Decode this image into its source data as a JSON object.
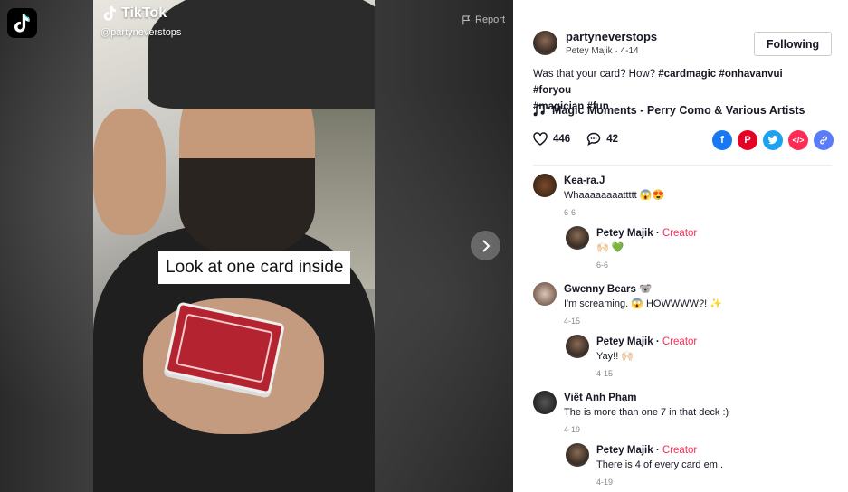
{
  "app": {
    "brand": "TikTok",
    "handle": "@partyneverstops",
    "report_label": "Report"
  },
  "video": {
    "caption": "Look at one card inside"
  },
  "post": {
    "author": "partyneverstops",
    "author_sub": "Petey Majik · 4-14",
    "follow_label": "Following",
    "description": "Was that your card? How? ",
    "hashtags": [
      "#cardmagic",
      "#onhavanvui",
      "#foryou",
      "#magician",
      "#fun"
    ],
    "music": "Magic Moments - Perry Como & Various Artists",
    "likes": "446",
    "comments_count": "42"
  },
  "share_colors": {
    "facebook": "#1877f2",
    "pinterest": "#e60023",
    "twitter": "#1da1f2",
    "embed": "#fe2c55",
    "link": "#5b7cfa"
  },
  "comments": [
    {
      "name": "Kea-ra.J",
      "text": "Whaaaaaaaattttt 😱😍",
      "date": "6-6",
      "reply": {
        "name": "Petey Majik",
        "creator": "Creator",
        "text": "🙌🏻 💚",
        "date": "6-6"
      }
    },
    {
      "name": "Gwenny Bears 🐨",
      "text": "I'm screaming. 😱 HOWWWW?! ✨",
      "date": "4-15",
      "reply": {
        "name": "Petey Majik",
        "creator": "Creator",
        "text": "Yay!! 🙌🏻",
        "date": "4-15"
      }
    },
    {
      "name": "Việt Anh Phạm",
      "text": "The is more than one 7 in that deck :)",
      "date": "4-19",
      "reply": {
        "name": "Petey Majik",
        "creator": "Creator",
        "text": "There is 4 of every card em..",
        "date": "4-19"
      }
    }
  ]
}
